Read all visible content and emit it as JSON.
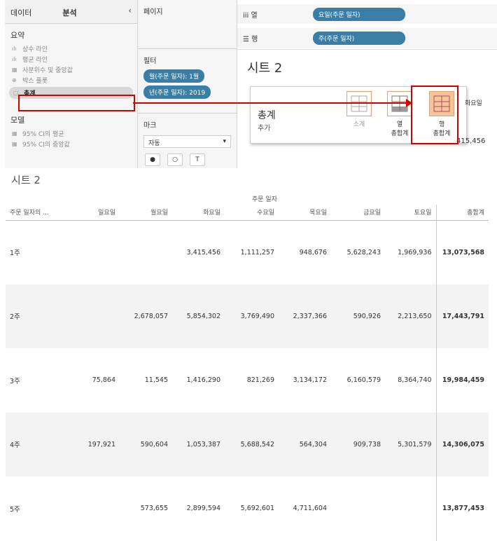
{
  "left": {
    "tabs": [
      "데이터",
      "분석"
    ],
    "summary_title": "요약",
    "summary_items": [
      {
        "icon": "bar-icon",
        "label": "상수 라인"
      },
      {
        "icon": "bar-icon",
        "label": "평균 라인"
      },
      {
        "icon": "box-icon",
        "label": "사분위수 및 중앙값"
      },
      {
        "icon": "box-icon",
        "label": "박스 플롯"
      },
      {
        "icon": "square-icon",
        "label": "총계"
      }
    ],
    "model_title": "모델",
    "model_items": [
      {
        "icon": "box-icon",
        "label": "95% CI의 평균"
      },
      {
        "icon": "box-icon",
        "label": "95% CI의 중앙값"
      }
    ]
  },
  "mid": {
    "pages_title": "페이지",
    "filters_title": "필터",
    "filters": [
      "월(주문 일자): 1월",
      "년(주문 일자): 2019"
    ],
    "marks_title": "마크",
    "marks_type": "자동"
  },
  "shelves": {
    "columns_label": "열",
    "columns_pill": "요일(주문 일자)",
    "rows_label": "행",
    "rows_pill": "주(주문 일자)"
  },
  "view": {
    "sheet_title": "시트 2",
    "popup_title": "총계",
    "popup_sub": "추가",
    "options": [
      {
        "line1": "소계",
        "line2": ""
      },
      {
        "line1": "열",
        "line2": "총합계"
      },
      {
        "line1": "행",
        "line2": "총합계"
      }
    ],
    "peek_header": "화요일",
    "peek_value": "415,456"
  },
  "table": {
    "sheet_title": "시트 2",
    "col_group": "주문 일자",
    "row_header": "주문 일자의 ...",
    "columns": [
      "일요일",
      "월요일",
      "화요일",
      "수요일",
      "목요일",
      "금요일",
      "토요일",
      "총합계"
    ],
    "rows": [
      {
        "label": "1주",
        "values": [
          "",
          "",
          "3,415,456",
          "1,111,257",
          "948,676",
          "5,628,243",
          "1,969,936",
          "13,073,568"
        ]
      },
      {
        "label": "2주",
        "values": [
          "",
          "2,678,057",
          "5,854,302",
          "3,769,490",
          "2,337,366",
          "590,926",
          "2,213,650",
          "17,443,791"
        ]
      },
      {
        "label": "3주",
        "values": [
          "75,864",
          "11,545",
          "1,416,290",
          "821,269",
          "3,134,172",
          "6,160,579",
          "8,364,740",
          "19,984,459"
        ]
      },
      {
        "label": "4주",
        "values": [
          "197,921",
          "590,604",
          "1,053,387",
          "5,688,542",
          "564,304",
          "909,738",
          "5,301,579",
          "14,306,075"
        ]
      },
      {
        "label": "5주",
        "values": [
          "",
          "573,655",
          "2,899,594",
          "5,692,601",
          "4,711,604",
          "",
          "",
          "13,877,453"
        ]
      }
    ]
  }
}
